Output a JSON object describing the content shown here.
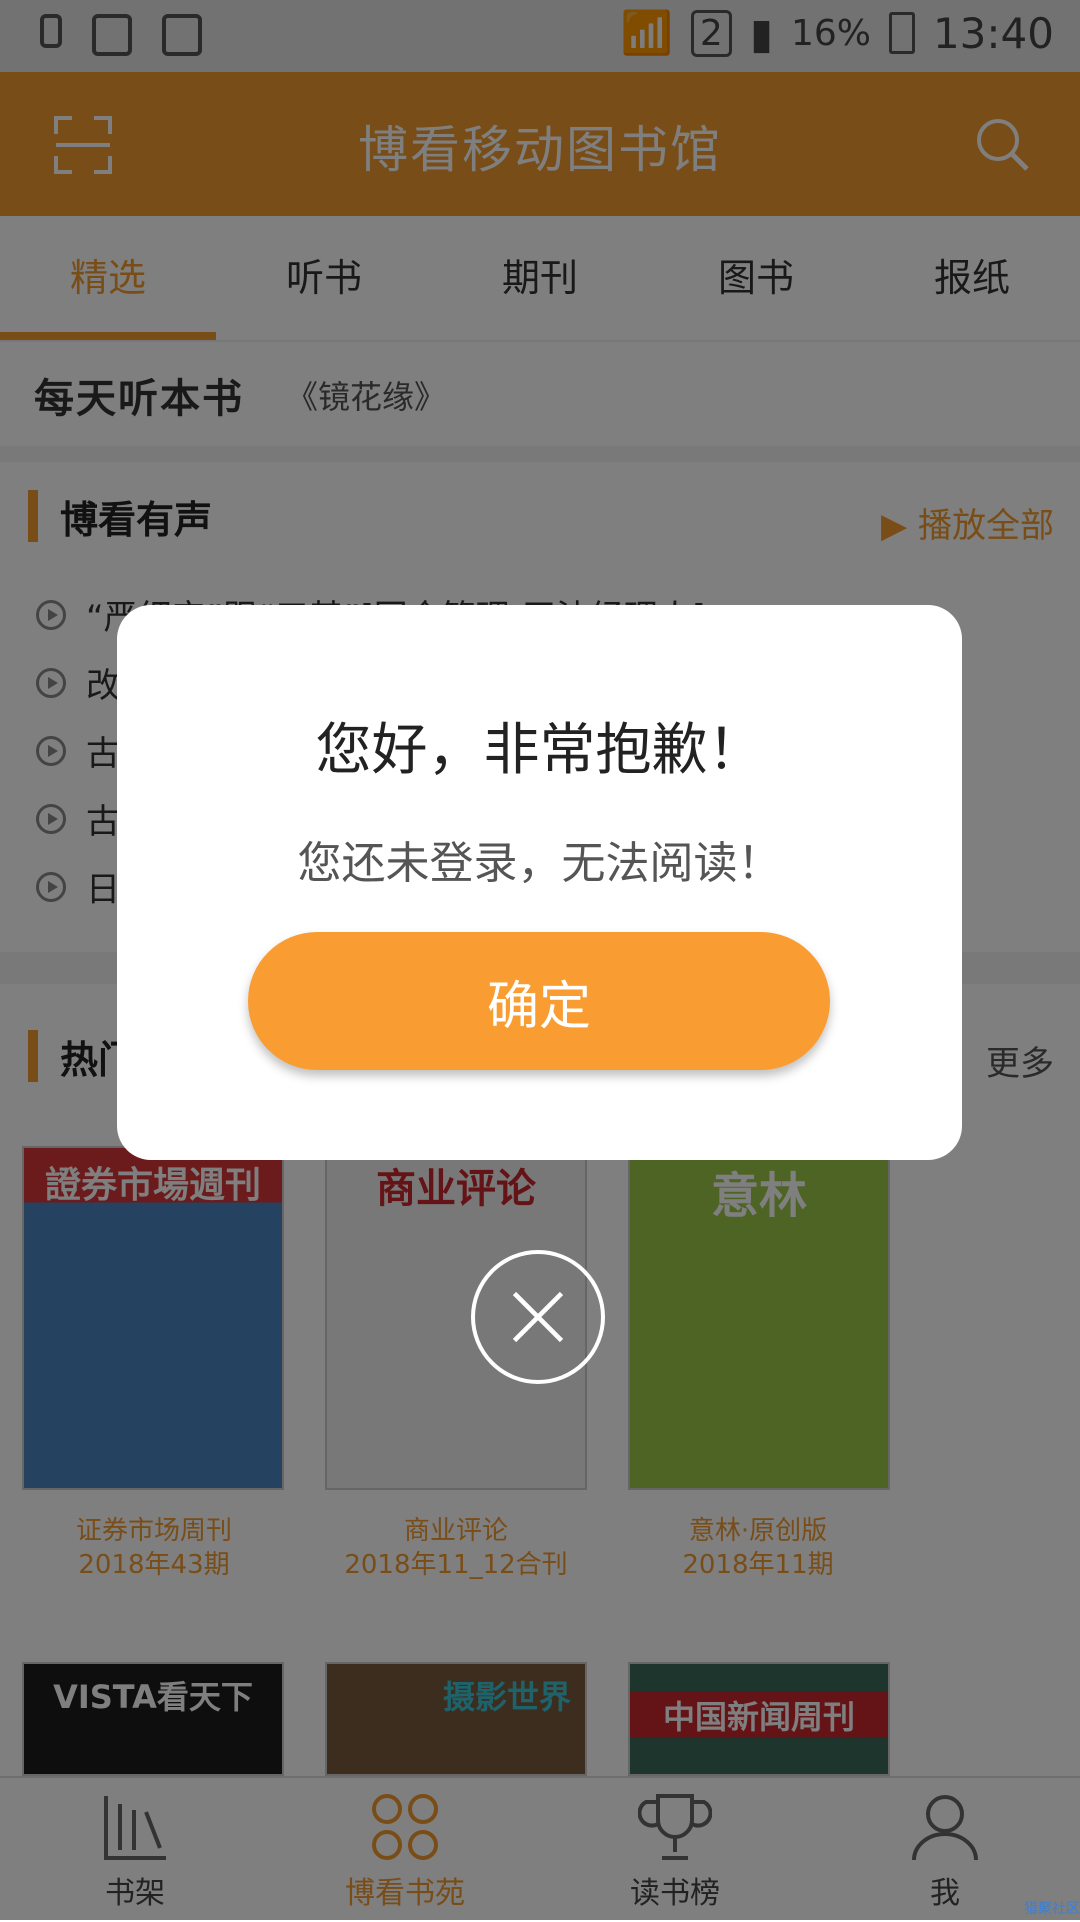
{
  "status_bar": {
    "battery": "16%",
    "time": "13:40",
    "sim": "2"
  },
  "header": {
    "title": "博看移动图书馆"
  },
  "tabs": [
    {
      "label": "精选"
    },
    {
      "label": "听书"
    },
    {
      "label": "期刊"
    },
    {
      "label": "图书"
    },
    {
      "label": "报纸"
    }
  ],
  "daily_listen": {
    "logo": "每天听本书",
    "book": "《镜花缘》"
  },
  "audio_section": {
    "title": "博看有声",
    "play_all": "播放全部",
    "items": [
      {
        "text": "“严细实”跟“三基”[国企管理-王沐经理人]"
      },
      {
        "text": "改"
      },
      {
        "text": "古"
      },
      {
        "text": "古"
      },
      {
        "text": "日"
      }
    ]
  },
  "hot_section": {
    "title": "热门",
    "more": "更多",
    "magazines": [
      {
        "cover": "證券市場週刊",
        "name": "证券市场周刊",
        "issue": "2018年43期"
      },
      {
        "cover": "商业评论",
        "name": "商业评论",
        "issue": "2018年11_12合刊"
      },
      {
        "cover": "意林",
        "name": "意林·原创版",
        "issue": "2018年11期"
      }
    ],
    "row2": [
      {
        "cover": "VISTA看天下"
      },
      {
        "cover": "摄影世界"
      },
      {
        "cover": "中国新闻周刊"
      }
    ]
  },
  "bottom_nav": [
    {
      "label": "书架"
    },
    {
      "label": "博看书苑"
    },
    {
      "label": "读书榜"
    },
    {
      "label": "我"
    }
  ],
  "dialog": {
    "title": "您好，非常抱歉！",
    "message": "您还未登录，无法阅读！",
    "confirm": "确定"
  },
  "watermark": "猎聚社区"
}
